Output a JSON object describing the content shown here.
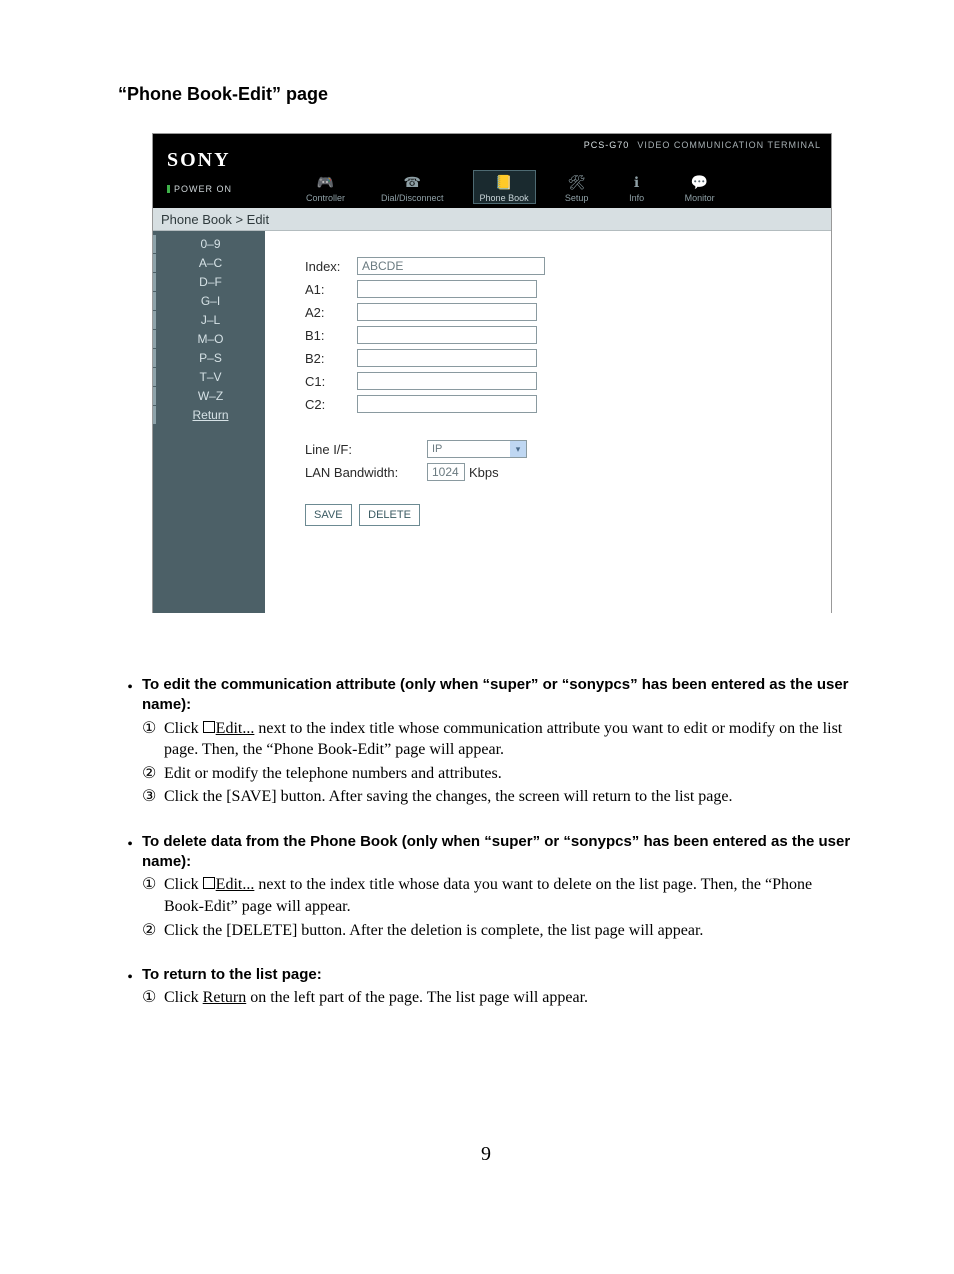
{
  "page_title": "“Phone Book-Edit” page",
  "page_number": "9",
  "screenshot": {
    "brand": "SONY",
    "power": "POWER ON",
    "model": "PCS-G70",
    "tagline": "VIDEO COMMUNICATION TERMINAL",
    "nav": {
      "controller": "Controller",
      "dial": "Dial/Disconnect",
      "phonebook": "Phone Book",
      "setup": "Setup",
      "info": "Info",
      "monitor": "Monitor"
    },
    "breadcrumb": "Phone Book > Edit",
    "side": {
      "i0": "0–9",
      "i1": "A–C",
      "i2": "D–F",
      "i3": "G–I",
      "i4": "J–L",
      "i5": "M–O",
      "i6": "P–S",
      "i7": "T–V",
      "i8": "W–Z",
      "ret": "Return"
    },
    "form": {
      "index_label": "Index:",
      "index_value": "ABCDE",
      "a1": "A1:",
      "a2": "A2:",
      "b1": "B1:",
      "b2": "B2:",
      "c1": "C1:",
      "c2": "C2:",
      "lineif_label": "Line I/F:",
      "lineif_value": "IP",
      "lanbw_label": "LAN Bandwidth:",
      "lanbw_value": "1024",
      "lanbw_unit": "Kbps",
      "save": "SAVE",
      "delete": "DELETE"
    }
  },
  "instr": {
    "h1": "To edit the communication attribute (only when “super” or “sonypcs” has been entered as the user name):",
    "l1a": "Click ",
    "edit": "Edit...",
    "l1b": " next to the index title whose communication attribute you want to edit or modify on the list page. Then, the “Phone Book-Edit” page will appear.",
    "l2": "Edit or modify the telephone numbers and attributes.",
    "l3": "Click the [SAVE] button. After saving the changes, the screen will return to the list page.",
    "h2": "To delete data from the Phone Book (only when “super” or “sonypcs” has been entered as the user name):",
    "d1a": "Click ",
    "d1b": " next to the index title whose data you want to delete on the list page. Then, the “Phone Book-Edit” page will appear.",
    "d2": "Click the [DELETE] button. After the deletion is complete, the list page will appear.",
    "h3": "To return to the list page:",
    "r1a": "Click ",
    "return": "Return",
    "r1b": " on the left part of the page. The list page will appear."
  }
}
